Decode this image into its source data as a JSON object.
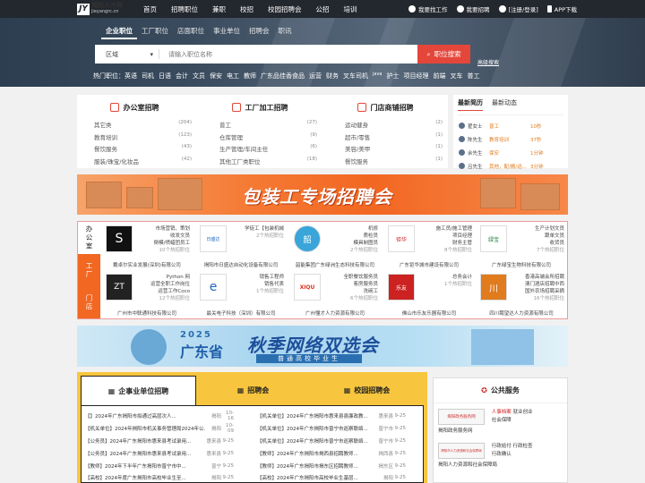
{
  "topbar": {
    "logo_mark": "JY",
    "logo_title": "揭阳人才网",
    "logo_sub": "jieyangrc.cn",
    "nav": [
      "首页",
      "招聘职位",
      "兼职",
      "校招",
      "校园招聘会",
      "公招",
      "培训"
    ],
    "user_links": [
      {
        "icon": "search-icon",
        "label": "我要找工作"
      },
      {
        "icon": "person-icon",
        "label": "我要招聘"
      },
      {
        "icon": "user-icon",
        "label": "[注册/登录]"
      },
      {
        "icon": "phone-icon",
        "label": "APP下载"
      }
    ]
  },
  "search": {
    "tabs": [
      "企业职位",
      "工厂职位",
      "店面职位",
      "事业单位",
      "招聘会",
      "职讯"
    ],
    "active_tab": "企业职位",
    "area_label": "区域",
    "placeholder": "请输入职位名称",
    "button": "职位搜索",
    "advanced": "高级搜索",
    "hot_label": "热门职位：",
    "hot": [
      "英语",
      "司机",
      "日语",
      "会计",
      "文员",
      "保安",
      "电工",
      "教师",
      "广东品佳香食品",
      "运营",
      "财务",
      "叉车司机",
      "java",
      "护士",
      "项目经理",
      "前端",
      "叉车",
      "普工"
    ]
  },
  "categories": [
    {
      "title": "办公室招聘",
      "items": [
        {
          "name": "其它类",
          "count": "(204)"
        },
        {
          "name": "教育培训",
          "count": "(123)"
        },
        {
          "name": "餐饮服务",
          "count": "(43)"
        },
        {
          "name": "服装/珠宝/化妆品",
          "count": "(42)"
        }
      ]
    },
    {
      "title": "工厂加工招聘",
      "items": [
        {
          "name": "普工",
          "count": "(27)"
        },
        {
          "name": "仓库管理",
          "count": "(9)"
        },
        {
          "name": "生产管理/车间主任",
          "count": "(6)"
        },
        {
          "name": "其他工厂类职位",
          "count": "(18)"
        }
      ]
    },
    {
      "title": "门店商铺招聘",
      "items": [
        {
          "name": "运动健身",
          "count": "(2)"
        },
        {
          "name": "超市/零售",
          "count": "(1)"
        },
        {
          "name": "美容/美甲",
          "count": "(1)"
        },
        {
          "name": "餐饮服务",
          "count": "(1)"
        }
      ]
    }
  ],
  "latest": {
    "tabs": [
      "最新简历",
      "最新动态"
    ],
    "rows": [
      {
        "name": "翟女士",
        "job": "普工",
        "time": "10秒"
      },
      {
        "name": "陈先生",
        "job": "教育培训",
        "time": "37秒"
      },
      {
        "name": "余先生",
        "job": "保安",
        "time": "1分钟"
      },
      {
        "name": "吕先生",
        "job": "其他，配/搬/运...",
        "time": "3分钟"
      }
    ]
  },
  "banner1": {
    "title": "包装工专场招聘会"
  },
  "company_tabs": [
    "办公室",
    "工厂",
    "门店"
  ],
  "companies": [
    {
      "logo": "S",
      "jobs": [
        "市场营销、策划",
        "收发文员",
        "倒模/喷蜡团员工"
      ],
      "count": "10个热招职位",
      "name": "戴卓尔实业发展(深圳)有限公司"
    },
    {
      "logo": "日盛达",
      "jobs": [
        "学徒工【包装机械",
        "2个热招职位"
      ],
      "count": "",
      "name": "揭阳市日盛达自动化设备有限公司"
    },
    {
      "logo": "韶",
      "jobs": [
        "机修",
        "质检员",
        "模具制图员",
        "2个热招职位"
      ],
      "count": "",
      "name": "韶能集团广东绿洲生态科技有限公司"
    },
    {
      "logo": "钜华",
      "jobs": [
        "施工员/施工管理",
        "项目经理",
        "财务主管",
        "8个热招职位"
      ],
      "count": "",
      "name": "广东钜华城市建设有限公司"
    },
    {
      "logo": "绿宝",
      "jobs": [
        "生产计划文员",
        "跟单文员",
        "收货员",
        "7个热招职位"
      ],
      "count": "",
      "name": "广东绿宝生物科技有限公司"
    },
    {
      "logo": "ZT",
      "jobs": [
        "Python 网",
        "运营全职工作岗位",
        "运营工作Coco",
        "12个热招职位"
      ],
      "count": "",
      "name": "广州市中联通科技有限公司"
    },
    {
      "logo": "e",
      "jobs": [
        "销售工程师",
        "销售代表",
        "1个热招职位"
      ],
      "count": "",
      "name": "最关电子科技（深圳）有限公司"
    },
    {
      "logo": "XIQU",
      "jobs": [
        "全职餐饮服务员",
        "客房服务员",
        "洗碗工",
        "6个热招职位"
      ],
      "count": "",
      "name": "广州懂才人力资源有限公司"
    },
    {
      "logo": "乐友",
      "jobs": [
        "总务会计",
        "1个热招职位"
      ],
      "count": "",
      "name": "佛山市乐友乐器有限公司"
    },
    {
      "logo": "川",
      "jobs": [
        "香港高端会所招聘",
        "澳门酒店招聘中西",
        "国外农场招聘采摘",
        "16个热招职位"
      ],
      "count": "",
      "name": "四川聘望达人力资源有限公司"
    }
  ],
  "banner2": {
    "year": "2025",
    "region": "广东省",
    "title": "秋季网络双选会",
    "subtitle": "普通高校毕业生"
  },
  "job_tabs": [
    "企事业单位招聘",
    "招聘会",
    "校园招聘会"
  ],
  "job_list_left": [
    {
      "text": "【】2024年广东揭阳市拟通过高层次人...",
      "area": "揭阳",
      "date": "10-16"
    },
    {
      "text": "【机关单位】2024年揭阳市机关事务管理局2024年公...",
      "area": "揭阳",
      "date": "10-09"
    },
    {
      "text": "【公务员】2024年广东揭阳市惠来县考试录用...",
      "area": "惠来县",
      "date": "9-25"
    },
    {
      "text": "【公务员】2024年广东揭阳市惠来县考试录用...",
      "area": "惠来县",
      "date": "9-25"
    },
    {
      "text": "【教师】2024年下半年广东揭阳市普宁市中...",
      "area": "普宁",
      "date": "9-25"
    },
    {
      "text": "【高校】2024年度广东揭阳市高校毕业生至...",
      "area": "揭阳",
      "date": "9-25"
    }
  ],
  "job_list_right": [
    {
      "text": "【机关单位】2024年广东揭阳市惠来县县廉政教...",
      "area": "惠来县",
      "date": "9-25"
    },
    {
      "text": "【机关单位】2024年广东揭阳市普宁市巡察联络...",
      "area": "普宁市",
      "date": "9-25"
    },
    {
      "text": "【机关单位】2024年广东揭阳市普宁市巡察联络...",
      "area": "普宁市",
      "date": "9-25"
    },
    {
      "text": "【教师】2024年广东揭阳市揭西县招聘教师...",
      "area": "揭西县",
      "date": "9-25"
    },
    {
      "text": "【教师】2024年广东揭阳市揭东区招聘教师...",
      "area": "揭东区",
      "date": "9-25"
    },
    {
      "text": "【高校】2024年广东揭阳市高校毕业生基层...",
      "area": "揭阳",
      "date": "9-25"
    }
  ],
  "public_service": {
    "title": "公共服务",
    "items": [
      {
        "img": "揭阳政务服务网",
        "links": [
          "人事档案",
          "就业创业",
          "社会保障"
        ],
        "caption": "揭阳政务服务网"
      },
      {
        "img": "揭阳市人力资源和社会保障局",
        "links": [
          "行政给付",
          "行政检查",
          "行政确认"
        ],
        "caption": "揭阳人力资源和社会保障局"
      }
    ]
  },
  "colors": {
    "accent": "#e4463a",
    "topbar": "#23272e",
    "orange": "#f26722",
    "yellow": "#f8c63e"
  }
}
